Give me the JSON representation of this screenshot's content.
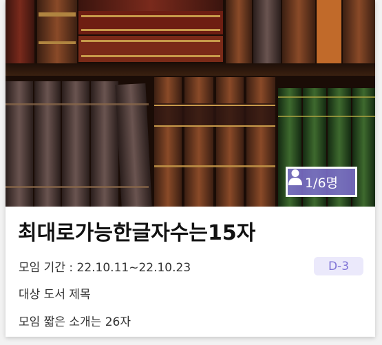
{
  "group": {
    "member_count": "1/6명",
    "name": "최대로가능한글자수는15자",
    "period_label": "모임 기간 : 22.10.11~22.10.23",
    "dday": "D-3",
    "book_title": "대상 도서 제목",
    "short_intro": "모임 짧은 소개는 26자"
  },
  "icons": {
    "member": "person-icon"
  },
  "colors": {
    "badge_bg": "#7d70cd",
    "dday_bg": "#ebe9fb",
    "dday_text": "#7f73d6"
  }
}
